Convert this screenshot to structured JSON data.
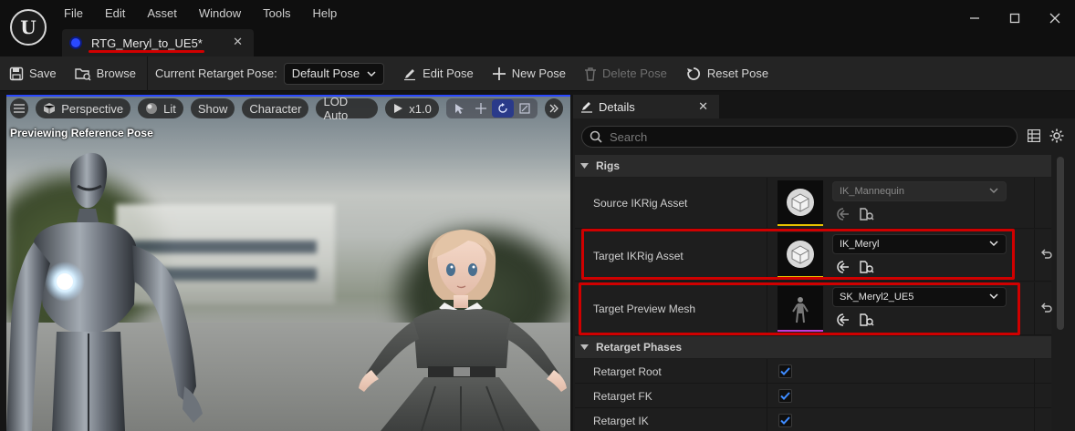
{
  "menu": [
    "File",
    "Edit",
    "Asset",
    "Window",
    "Tools",
    "Help"
  ],
  "tab": {
    "label": "RTG_Meryl_to_UE5*"
  },
  "toolbar": {
    "save": "Save",
    "browse": "Browse",
    "current_pose_label": "Current Retarget Pose:",
    "current_pose_value": "Default Pose",
    "edit_pose": "Edit Pose",
    "new_pose": "New Pose",
    "delete_pose": "Delete Pose",
    "reset_pose": "Reset Pose"
  },
  "viewport": {
    "view_mode": "Perspective",
    "lighting": "Lit",
    "show": "Show",
    "character": "Character",
    "lod": "LOD Auto",
    "speed": "x1.0",
    "status": "Previewing Reference Pose"
  },
  "details": {
    "tab_label": "Details",
    "search_placeholder": "Search",
    "sections": {
      "rigs": "Rigs",
      "retarget_phases": "Retarget Phases"
    },
    "rows": {
      "source_ikrig": {
        "label": "Source IKRig Asset",
        "value": "IK_Mannequin"
      },
      "target_ikrig": {
        "label": "Target IKRig Asset",
        "value": "IK_Meryl"
      },
      "target_preview_mesh": {
        "label": "Target Preview Mesh",
        "value": "SK_Meryl2_UE5"
      }
    },
    "phases": [
      {
        "label": "Retarget Root",
        "checked": true
      },
      {
        "label": "Retarget FK",
        "checked": true
      },
      {
        "label": "Retarget IK",
        "checked": true
      }
    ]
  },
  "colors": {
    "highlight": "#d00000",
    "accent_blue": "#2a49ff",
    "checkbox_check": "#3f8cff"
  }
}
